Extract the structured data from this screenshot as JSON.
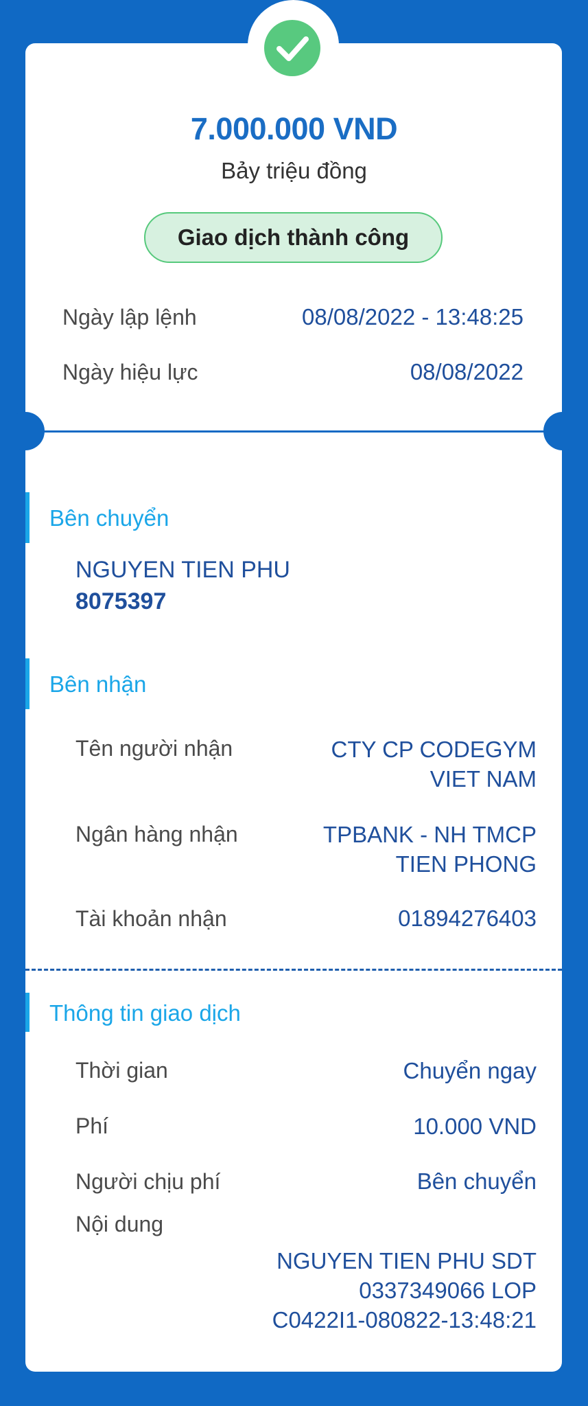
{
  "receipt": {
    "amount": "7.000.000 VND",
    "amount_words": "Bảy triệu đồng",
    "status": "Giao dịch thành công",
    "created_label": "Ngày lập lệnh",
    "created_value": "08/08/2022 - 13:48:25",
    "effective_label": "Ngày hiệu lực",
    "effective_value": "08/08/2022"
  },
  "sender": {
    "title": "Bên chuyển",
    "name": "NGUYEN TIEN PHU",
    "account": "8075397"
  },
  "receiver": {
    "title": "Bên nhận",
    "name_label": "Tên người nhận",
    "name_line1": "CTY CP CODEGYM",
    "name_line2": "VIET NAM",
    "bank_label": "Ngân hàng nhận",
    "bank_line1": "TPBANK - NH TMCP",
    "bank_line2": "TIEN PHONG",
    "account_label": "Tài khoản nhận",
    "account_value": "01894276403"
  },
  "transaction": {
    "title": "Thông tin giao dịch",
    "time_label": "Thời gian",
    "time_value": "Chuyển ngay",
    "fee_label": "Phí",
    "fee_value": "10.000 VND",
    "payer_label": "Người chịu phí",
    "payer_value": "Bên chuyển",
    "content_label": "Nội dung",
    "content_line1": "NGUYEN TIEN PHU SDT",
    "content_line2": "0337349066 LOP",
    "content_line3": "C0422I1-080822-13:48:21"
  },
  "colors": {
    "background": "#1069c4",
    "amount": "#1a6dc4",
    "value_text": "#1f4f9c",
    "section_title": "#1aa6e8",
    "success": "#58c97f"
  }
}
